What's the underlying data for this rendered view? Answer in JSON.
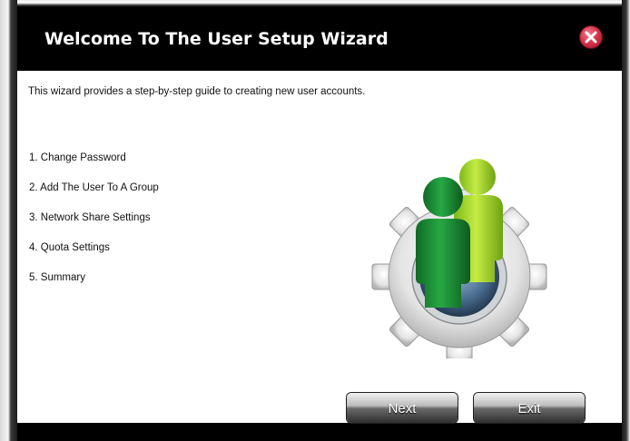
{
  "dialog": {
    "title": "Welcome To The User Setup Wizard",
    "intro": "This wizard provides a step-by-step guide to creating new user accounts.",
    "steps": [
      "1. Change Password",
      "2. Add The User To A Group",
      "3. Network Share Settings",
      "4. Quota Settings",
      "5. Summary"
    ],
    "buttons": {
      "next": "Next",
      "exit": "Exit"
    },
    "icons": {
      "close": "close-icon",
      "illustration": "users-gear-icon"
    },
    "colors": {
      "titlebar": "#000000",
      "close": "#d5344a",
      "user_front": "#1e9a3a",
      "user_back": "#9fd62a",
      "gear": "#e6e6e6"
    }
  }
}
